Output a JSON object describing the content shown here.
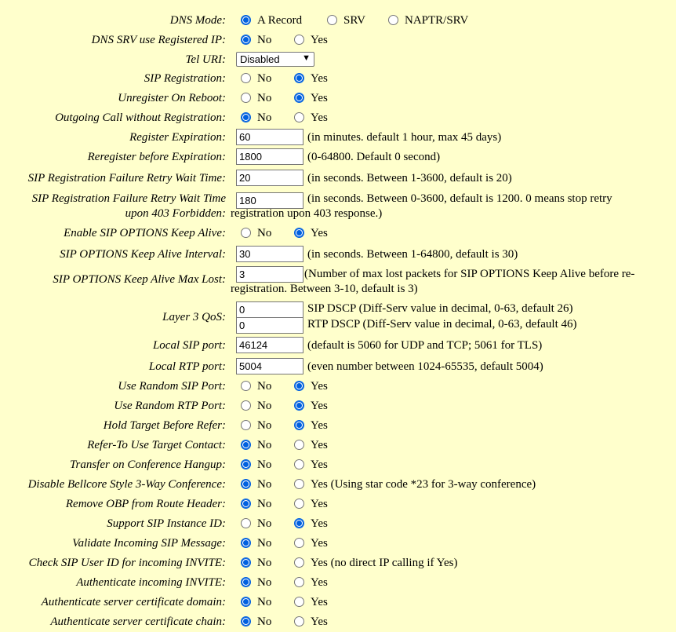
{
  "accent_color": "#0060df",
  "background_color": "#ffffcc",
  "dns_mode": {
    "label": "DNS Mode:",
    "options": [
      "A Record",
      "SRV",
      "NAPTR/SRV"
    ],
    "selected": "A Record"
  },
  "dns_srv_registered_ip": {
    "label": "DNS SRV use Registered IP:",
    "no": "No",
    "yes": "Yes",
    "selected": "No"
  },
  "tel_uri": {
    "label": "Tel URI:",
    "value": "Disabled",
    "arrow_icon": "chevron-down-icon"
  },
  "sip_registration": {
    "label": "SIP Registration:",
    "no": "No",
    "yes": "Yes",
    "selected": "Yes"
  },
  "unregister_on_reboot": {
    "label": "Unregister On Reboot:",
    "no": "No",
    "yes": "Yes",
    "selected": "Yes"
  },
  "outgoing_call_without_registration": {
    "label": "Outgoing Call without Registration:",
    "no": "No",
    "yes": "Yes",
    "selected": "No"
  },
  "register_expiration": {
    "label": "Register Expiration:",
    "value": "60",
    "note": "(in minutes. default 1 hour, max 45 days)"
  },
  "reregister_before_expiration": {
    "label": "Reregister before Expiration:",
    "value": "1800",
    "note": "(0-64800. Default 0 second)"
  },
  "reg_failure_retry_wait": {
    "label": "SIP Registration Failure Retry Wait Time:",
    "value": "20",
    "note": "(in seconds. Between 1-3600, default is 20)"
  },
  "reg_failure_retry_wait_403": {
    "label_line1": "SIP Registration Failure Retry Wait Time",
    "label_line2": "upon 403 Forbidden:",
    "value": "180",
    "note_line1": "(in seconds. Between 0-3600, default is 1200. 0 means stop retry",
    "note_line2": "registration upon 403 response.)"
  },
  "sip_options_keep_alive": {
    "label": "Enable SIP OPTIONS Keep Alive:",
    "no": "No",
    "yes": "Yes",
    "selected": "Yes"
  },
  "sip_options_interval": {
    "label": "SIP OPTIONS Keep Alive Interval:",
    "value": "30",
    "note": "(in seconds. Between 1-64800, default is 30)"
  },
  "sip_options_max_lost": {
    "label": "SIP OPTIONS Keep Alive Max Lost:",
    "value": "3",
    "note_line1": "(Number of max lost packets for SIP OPTIONS Keep Alive before re-",
    "note_line2": "registration. Between 3-10, default is 3)"
  },
  "layer3_qos": {
    "label": "Layer 3 QoS:",
    "sip_value": "0",
    "sip_note": "SIP DSCP (Diff-Serv value in decimal, 0-63, default 26)",
    "rtp_value": "0",
    "rtp_note": "RTP DSCP (Diff-Serv value in decimal, 0-63, default 46)"
  },
  "local_sip_port": {
    "label": "Local SIP port:",
    "value": "46124",
    "note": "(default is 5060 for UDP and TCP; 5061 for TLS)"
  },
  "local_rtp_port": {
    "label": "Local RTP port:",
    "value": "5004",
    "note": "(even number between 1024-65535, default 5004)"
  },
  "radio_rows": [
    {
      "label": "Use Random SIP Port:",
      "no": "No",
      "yes": "Yes",
      "selected": "Yes"
    },
    {
      "label": "Use Random RTP Port:",
      "no": "No",
      "yes": "Yes",
      "selected": "Yes"
    },
    {
      "label": "Hold Target Before Refer:",
      "no": "No",
      "yes": "Yes",
      "selected": "Yes"
    },
    {
      "label": "Refer-To Use Target Contact:",
      "no": "No",
      "yes": "Yes",
      "selected": "No"
    },
    {
      "label": "Transfer on Conference Hangup:",
      "no": "No",
      "yes": "Yes",
      "selected": "No"
    },
    {
      "label": "Disable Bellcore Style 3-Way Conference:",
      "no": "No",
      "yes": "Yes (Using star code *23 for 3-way conference)",
      "selected": "No"
    },
    {
      "label": "Remove OBP from Route Header:",
      "no": "No",
      "yes": "Yes",
      "selected": "No"
    },
    {
      "label": "Support SIP Instance ID:",
      "no": "No",
      "yes": "Yes",
      "selected": "Yes"
    },
    {
      "label": "Validate Incoming SIP Message:",
      "no": "No",
      "yes": "Yes",
      "selected": "No"
    },
    {
      "label": "Check SIP User ID for incoming INVITE:",
      "no": "No",
      "yes": "Yes (no direct IP calling if Yes)",
      "selected": "No"
    },
    {
      "label": "Authenticate incoming INVITE:",
      "no": "No",
      "yes": "Yes",
      "selected": "No"
    },
    {
      "label": "Authenticate server certificate domain:",
      "no": "No",
      "yes": "Yes",
      "selected": "No"
    },
    {
      "label": "Authenticate server certificate chain:",
      "no": "No",
      "yes": "Yes",
      "selected": "No"
    }
  ]
}
